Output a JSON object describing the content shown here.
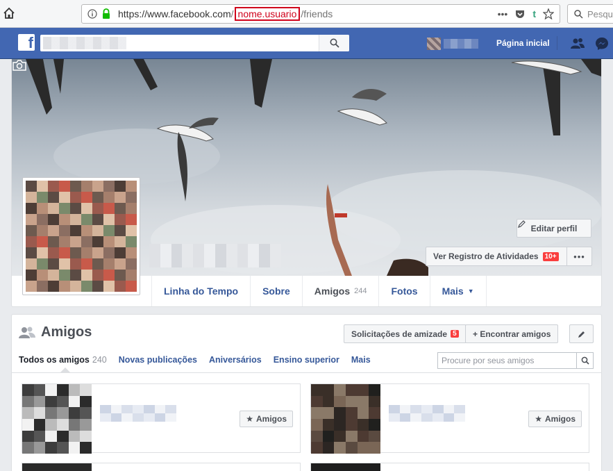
{
  "browser": {
    "url_prefix": "https://www.facebook.com",
    "url_slash1": "/",
    "url_highlight": "nome.usuario",
    "url_slash2": "/",
    "url_suffix": "friends",
    "search_placeholder": "Pesqu"
  },
  "fb_header": {
    "home_label": "Página inicial"
  },
  "profile": {
    "actions": {
      "edit_profile": "Editar perfil",
      "activity_log": "Ver Registro de Atividades",
      "activity_badge": "10+",
      "more": "•••"
    },
    "tabs": [
      {
        "label": "Linha do Tempo"
      },
      {
        "label": "Sobre"
      },
      {
        "label": "Amigos",
        "count": "244"
      },
      {
        "label": "Fotos"
      },
      {
        "label": "Mais"
      }
    ]
  },
  "friends": {
    "title": "Amigos",
    "requests_label": "Solicitações de amizade",
    "requests_badge": "5",
    "find_label": "+ Encontrar amigos",
    "subtabs": [
      {
        "label": "Todos os amigos",
        "count": "240"
      },
      {
        "label": "Novas publicações"
      },
      {
        "label": "Aniversários"
      },
      {
        "label": "Ensino superior"
      },
      {
        "label": "Mais"
      }
    ],
    "search_placeholder": "Procure por seus amigos",
    "card_button": "Amigos"
  }
}
